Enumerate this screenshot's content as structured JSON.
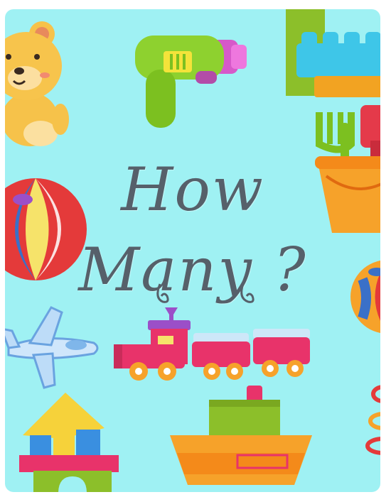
{
  "title": {
    "line1": "How",
    "line2": "Many ?"
  },
  "colors": {
    "background": "#9ff1f3",
    "text": "#56606a"
  },
  "icons": [
    "teddy-bear-icon",
    "toy-gun-icon",
    "building-blocks-icon",
    "beach-ball-icon",
    "sand-bucket-icon",
    "ball-icon",
    "toy-airplane-icon",
    "toy-train-icon",
    "block-house-icon",
    "toy-boat-icon",
    "ring-stacker-icon"
  ]
}
